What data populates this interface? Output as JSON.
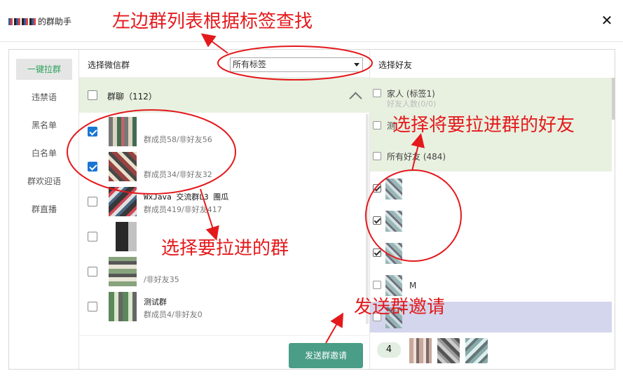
{
  "app": {
    "title_suffix": "的群助手",
    "close_glyph": "✕"
  },
  "sidebar": {
    "items": [
      {
        "label": "一键拉群",
        "active": true
      },
      {
        "label": "违禁语"
      },
      {
        "label": "黑名单"
      },
      {
        "label": "白名单"
      },
      {
        "label": "群欢迎语"
      },
      {
        "label": "群直播"
      }
    ]
  },
  "groups": {
    "header_label": "选择微信群",
    "tag_select_value": "所有标签",
    "category_title": "群聊（112）",
    "items": [
      {
        "name": "",
        "sub": "群成员58/非好友56",
        "checked": true
      },
      {
        "name": "",
        "sub": "群成员34/非好友32",
        "checked": true
      },
      {
        "name": "WxJava 交流群L3 團瓜",
        "sub": "群成员419/非好友417",
        "checked": false
      },
      {
        "name": "",
        "sub": "",
        "checked": false
      },
      {
        "name": "",
        "sub": "/非好友35",
        "checked": false
      },
      {
        "name": "测试群",
        "sub": "群成员4/非好友0",
        "checked": false
      }
    ],
    "send_button_label": "发送群邀请"
  },
  "friends": {
    "header_label": "选择好友",
    "tags": [
      {
        "name": "家人 (标签1)",
        "sub": "好友人数(0/0)"
      },
      {
        "name": "测",
        "sub": ""
      },
      {
        "name": "所有好友 (484)",
        "sub": ""
      }
    ],
    "list": [
      {
        "name": "",
        "checked": true
      },
      {
        "name": "",
        "checked": true
      },
      {
        "name": "",
        "checked": true
      },
      {
        "name": "M",
        "checked": false
      },
      {
        "name": "",
        "checked": false,
        "highlight": true
      }
    ],
    "selected_count": "4"
  },
  "annotations": {
    "top": "左边群列表根据标签查找",
    "friends": "选择将要拉进群的好友",
    "groups": "选择要拉进的群",
    "send": "发送群邀请"
  },
  "colors": {
    "accent_green": "#2ca35b",
    "send_button": "#4a9d86",
    "checkbox_blue": "#1976d2",
    "annotation_red": "#e4191c",
    "highlight_row": "#d3d6ec",
    "category_bg": "#e8f1e0"
  }
}
